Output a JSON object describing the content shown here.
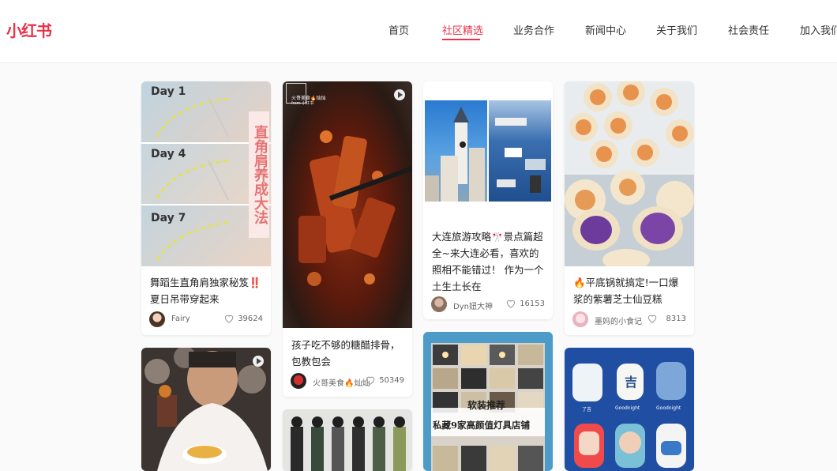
{
  "brand": {
    "logo": "小红书",
    "accent": "#e8334a"
  },
  "nav": {
    "items": [
      {
        "label": "首页"
      },
      {
        "label": "社区精选"
      },
      {
        "label": "业务合作"
      },
      {
        "label": "新闻中心"
      },
      {
        "label": "关于我们"
      },
      {
        "label": "社会责任"
      },
      {
        "label": "加入我们"
      }
    ],
    "active": "社区精选"
  },
  "cards": [
    {
      "title": "舞蹈生直角肩独家秘笈‼️夏日吊带穿起来",
      "author": "Fairy",
      "likes": "39624",
      "image_text": [
        "Day 1",
        "Day 4",
        "Day 7"
      ],
      "image_side_text": "直角肩养成大法"
    },
    {
      "title": "孩子吃不够的糖醋排骨，包教包会",
      "author": "火哥美食🔥灿灿",
      "likes": "50349",
      "image_overlay": "火哥美食🔥灿灿",
      "image_overlay_sub": "from 小红书",
      "video": true
    },
    {
      "title": "大连旅游攻略🎌景点篇超全~来大连必看，喜欢的照相不能错过！ 作为一个土生土长在",
      "author": "Dyn妞大神",
      "likes": "16153"
    },
    {
      "title": "🔥平底锅就搞定!一口爆浆的紫薯芝士仙豆糕",
      "author": "墨妈的小食记",
      "likes": "8313"
    },
    {
      "video": true
    },
    {},
    {
      "image_text": [
        "软装推荐",
        "私藏9家高颜值灯具店铺"
      ]
    },
    {
      "image_labels": [
        "吉",
        "Goodnight",
        "Goodnight",
        "了吉"
      ]
    }
  ]
}
